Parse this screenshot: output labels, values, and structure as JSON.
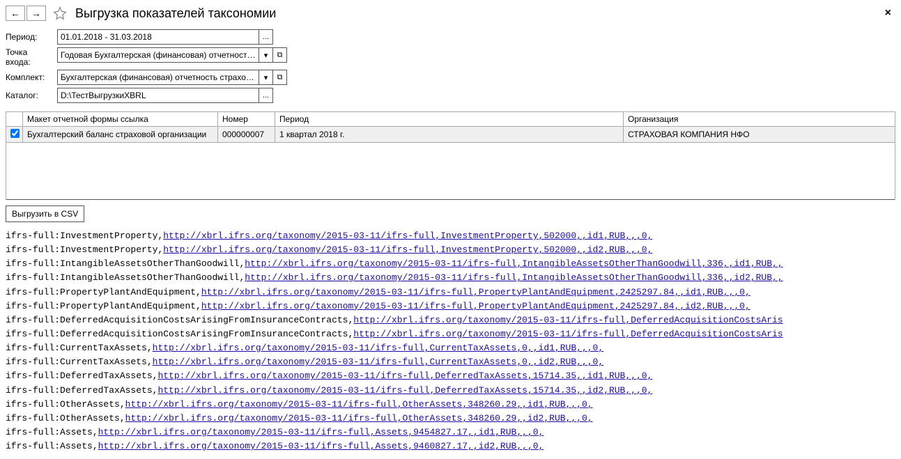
{
  "header": {
    "back_arrow": "←",
    "fwd_arrow": "→",
    "title": "Выгрузка показателей таксономии",
    "close": "×"
  },
  "form": {
    "period_label": "Период:",
    "period_value": "01.01.2018 - 31.03.2018",
    "period_btn": "...",
    "entry_label": "Точка входа:",
    "entry_value": "Годовая Бухгалтерская (финансовая) отчетность в сс",
    "entry_dd": "▾",
    "entry_open": "⧉",
    "kit_label": "Комплект:",
    "kit_value": "Бухгалтерская (финансовая) отчетность страховой ко",
    "kit_dd": "▾",
    "kit_open": "⧉",
    "catalog_label": "Каталог:",
    "catalog_value": "D:\\ТестВыгрузкиXBRL",
    "catalog_btn": "..."
  },
  "table": {
    "headers": {
      "chk": "",
      "form": "Макет отчетной формы ссылка",
      "num": "Номер",
      "period": "Период",
      "org": "Организация"
    },
    "row": {
      "checked": true,
      "form": "Бухгалтерский баланс страховой организации",
      "num": "000000007",
      "period": "1 квартал 2018 г.",
      "org": "СТРАХОВАЯ КОМПАНИЯ НФО"
    }
  },
  "export_btn": "Выгрузить в CSV",
  "output": [
    {
      "prefix": "ifrs-full:InvestmentProperty,",
      "link": "http://xbrl.ifrs.org/taxonomy/2015-03-11/ifrs-full,InvestmentProperty,502000,,id1,RUB,,,0,"
    },
    {
      "prefix": "ifrs-full:InvestmentProperty,",
      "link": "http://xbrl.ifrs.org/taxonomy/2015-03-11/ifrs-full,InvestmentProperty,502000,,id2,RUB,,,0,"
    },
    {
      "prefix": "ifrs-full:IntangibleAssetsOtherThanGoodwill,",
      "link": "http://xbrl.ifrs.org/taxonomy/2015-03-11/ifrs-full,IntangibleAssetsOtherThanGoodwill,336,,id1,RUB,,"
    },
    {
      "prefix": "ifrs-full:IntangibleAssetsOtherThanGoodwill,",
      "link": "http://xbrl.ifrs.org/taxonomy/2015-03-11/ifrs-full,IntangibleAssetsOtherThanGoodwill,336,,id2,RUB,,"
    },
    {
      "prefix": "ifrs-full:PropertyPlantAndEquipment,",
      "link": "http://xbrl.ifrs.org/taxonomy/2015-03-11/ifrs-full,PropertyPlantAndEquipment,2425297.84,,id1,RUB,,,0,"
    },
    {
      "prefix": "ifrs-full:PropertyPlantAndEquipment,",
      "link": "http://xbrl.ifrs.org/taxonomy/2015-03-11/ifrs-full,PropertyPlantAndEquipment,2425297.84,,id2,RUB,,,0,"
    },
    {
      "prefix": "ifrs-full:DeferredAcquisitionCostsArisingFromInsuranceContracts,",
      "link": "http://xbrl.ifrs.org/taxonomy/2015-03-11/ifrs-full,DeferredAcquisitionCostsAris"
    },
    {
      "prefix": "ifrs-full:DeferredAcquisitionCostsArisingFromInsuranceContracts,",
      "link": "http://xbrl.ifrs.org/taxonomy/2015-03-11/ifrs-full,DeferredAcquisitionCostsAris"
    },
    {
      "prefix": "ifrs-full:CurrentTaxAssets,",
      "link": "http://xbrl.ifrs.org/taxonomy/2015-03-11/ifrs-full,CurrentTaxAssets,0,,id1,RUB,,,0,"
    },
    {
      "prefix": "ifrs-full:CurrentTaxAssets,",
      "link": "http://xbrl.ifrs.org/taxonomy/2015-03-11/ifrs-full,CurrentTaxAssets,0,,id2,RUB,,,0,"
    },
    {
      "prefix": "ifrs-full:DeferredTaxAssets,",
      "link": "http://xbrl.ifrs.org/taxonomy/2015-03-11/ifrs-full,DeferredTaxAssets,15714.35,,id1,RUB,,,0,"
    },
    {
      "prefix": "ifrs-full:DeferredTaxAssets,",
      "link": "http://xbrl.ifrs.org/taxonomy/2015-03-11/ifrs-full,DeferredTaxAssets,15714.35,,id2,RUB,,,0,"
    },
    {
      "prefix": "ifrs-full:OtherAssets,",
      "link": "http://xbrl.ifrs.org/taxonomy/2015-03-11/ifrs-full,OtherAssets,348260.29,,id1,RUB,,,0,"
    },
    {
      "prefix": "ifrs-full:OtherAssets,",
      "link": "http://xbrl.ifrs.org/taxonomy/2015-03-11/ifrs-full,OtherAssets,348260.29,,id2,RUB,,,0,"
    },
    {
      "prefix": "ifrs-full:Assets,",
      "link": "http://xbrl.ifrs.org/taxonomy/2015-03-11/ifrs-full,Assets,9454827.17,,id1,RUB,,,0,"
    },
    {
      "prefix": "ifrs-full:Assets,",
      "link": "http://xbrl.ifrs.org/taxonomy/2015-03-11/ifrs-full,Assets,9460827.17,,id2,RUB,,,0,"
    }
  ]
}
